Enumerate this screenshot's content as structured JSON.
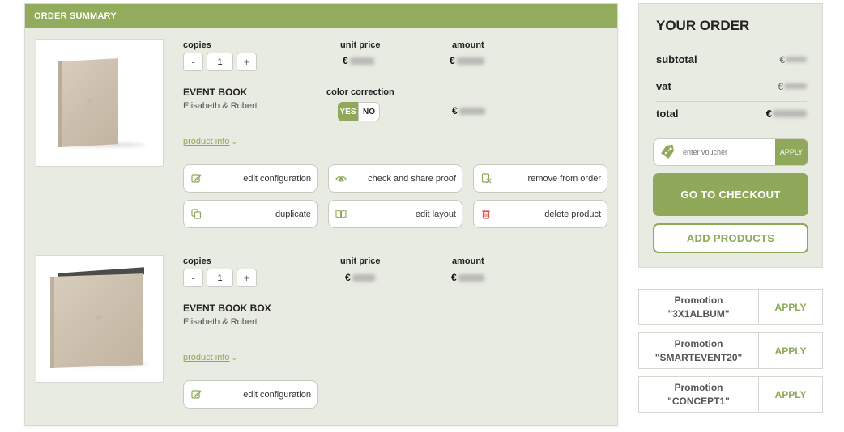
{
  "summary": {
    "title": "ORDER SUMMARY",
    "products": [
      {
        "name": "EVENT BOOK",
        "subtitle": "Elisabeth & Robert",
        "copies_label": "copies",
        "quantity": "1",
        "decrement": "-",
        "increment": "+",
        "unit_price_label": "unit price",
        "amount_label": "amount",
        "currency": "€",
        "color_correction_label": "color correction",
        "yes": "YES",
        "no": "NO",
        "product_info": "product info",
        "actions": [
          {
            "label": "edit configuration",
            "icon": "edit-icon"
          },
          {
            "label": "check and share proof",
            "icon": "eye-icon"
          },
          {
            "label": "remove from order",
            "icon": "remove-icon"
          },
          {
            "label": "duplicate",
            "icon": "duplicate-icon"
          },
          {
            "label": "edit layout",
            "icon": "book-open-icon"
          },
          {
            "label": "delete product",
            "icon": "trash-icon"
          }
        ]
      },
      {
        "name": "EVENT BOOK BOX",
        "subtitle": "Elisabeth & Robert",
        "copies_label": "copies",
        "quantity": "1",
        "decrement": "-",
        "increment": "+",
        "unit_price_label": "unit price",
        "amount_label": "amount",
        "currency": "€",
        "product_info": "product info",
        "actions": [
          {
            "label": "edit configuration",
            "icon": "edit-icon"
          }
        ]
      }
    ]
  },
  "order": {
    "title": "YOUR ORDER",
    "subtotal_label": "subtotal",
    "vat_label": "vat",
    "total_label": "total",
    "currency": "€",
    "voucher_placeholder": "enter voucher",
    "voucher_apply": "APPLY",
    "checkout": "GO TO CHECKOUT",
    "add_products": "ADD PRODUCTS"
  },
  "promotions": [
    {
      "label": "Promotion",
      "code": "\"3X1ALBUM\"",
      "apply": "APPLY"
    },
    {
      "label": "Promotion",
      "code": "\"SMARTEVENT20\"",
      "apply": "APPLY"
    },
    {
      "label": "Promotion",
      "code": "\"CONCEPT1\"",
      "apply": "APPLY"
    }
  ],
  "colors": {
    "accent": "#8fa85a",
    "header": "#93ab5c",
    "panel": "#e8ebe1",
    "danger": "#d9534f"
  }
}
